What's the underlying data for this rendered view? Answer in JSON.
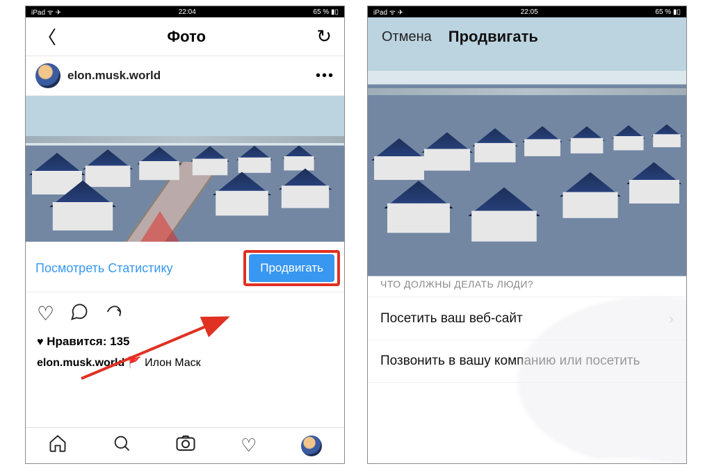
{
  "screen1": {
    "status": {
      "left": "iPad ᯤ ✈︎",
      "time": "22:04",
      "right": "65 % ▮▯"
    },
    "nav": {
      "title": "Фото"
    },
    "post": {
      "username": "elon.musk.world",
      "view_stats": "Посмотреть Статистику",
      "promote": "Продвигать",
      "likes_label": "Нравится: 135",
      "caption_user": "elon.musk.world",
      "caption_text": "Илон Маск"
    }
  },
  "screen2": {
    "status": {
      "left": "iPad ᯤ ✈︎",
      "time": "22:05",
      "right": "65 % ▮▯"
    },
    "nav": {
      "cancel": "Отмена",
      "title": "Продвигать"
    },
    "section_title": "ЧТО ДОЛЖНЫ ДЕЛАТЬ ЛЮДИ?",
    "options": [
      "Посетить ваш веб-сайт",
      "Позвонить в вашу компанию или посетить"
    ]
  }
}
